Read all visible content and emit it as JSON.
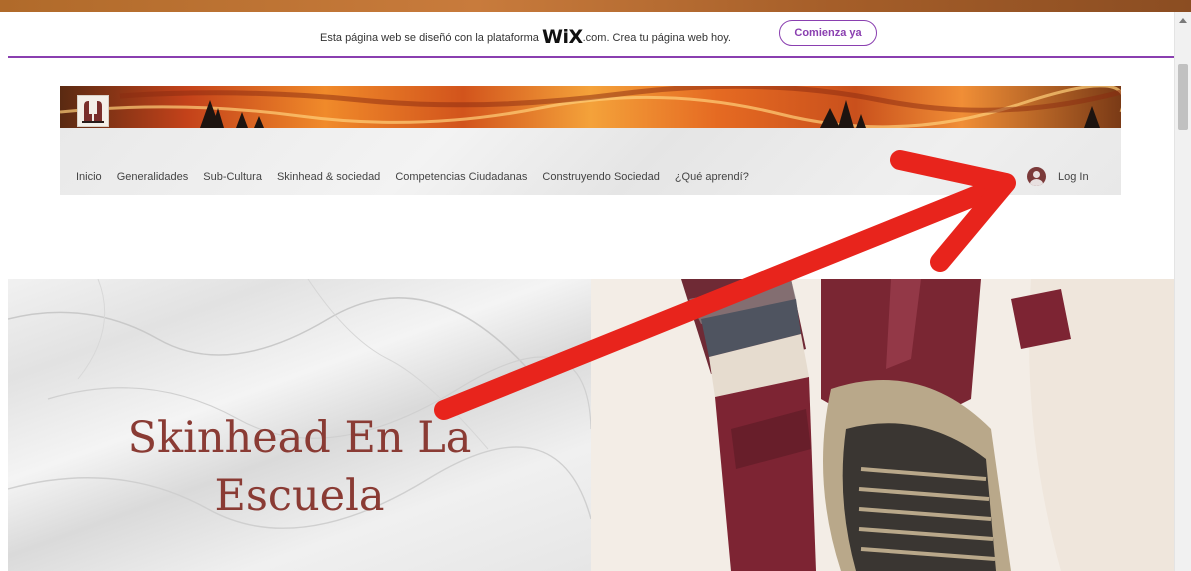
{
  "wix_banner": {
    "text_before": "Esta página web se diseñó con la plataforma",
    "logo": "WiX",
    "text_after": ".com. Crea tu página web hoy.",
    "cta_label": "Comienza ya",
    "accent_color": "#8a3fb0"
  },
  "header": {
    "nav_items": [
      "Inicio",
      "Generalidades",
      "Sub-Cultura",
      "Skinhead & sociedad",
      "Competencias Ciudadanas",
      "Construyendo Sociedad",
      "¿Qué aprendí?"
    ],
    "login_label": "Log In",
    "login_icon": "user-avatar-icon"
  },
  "hero": {
    "title_line1": "Skinhead En La",
    "title_line2": "Escuela",
    "title_color": "#8a3b34"
  },
  "annotation": {
    "arrow_color": "#e8241c",
    "arrow_icon": "red-arrow-icon"
  }
}
